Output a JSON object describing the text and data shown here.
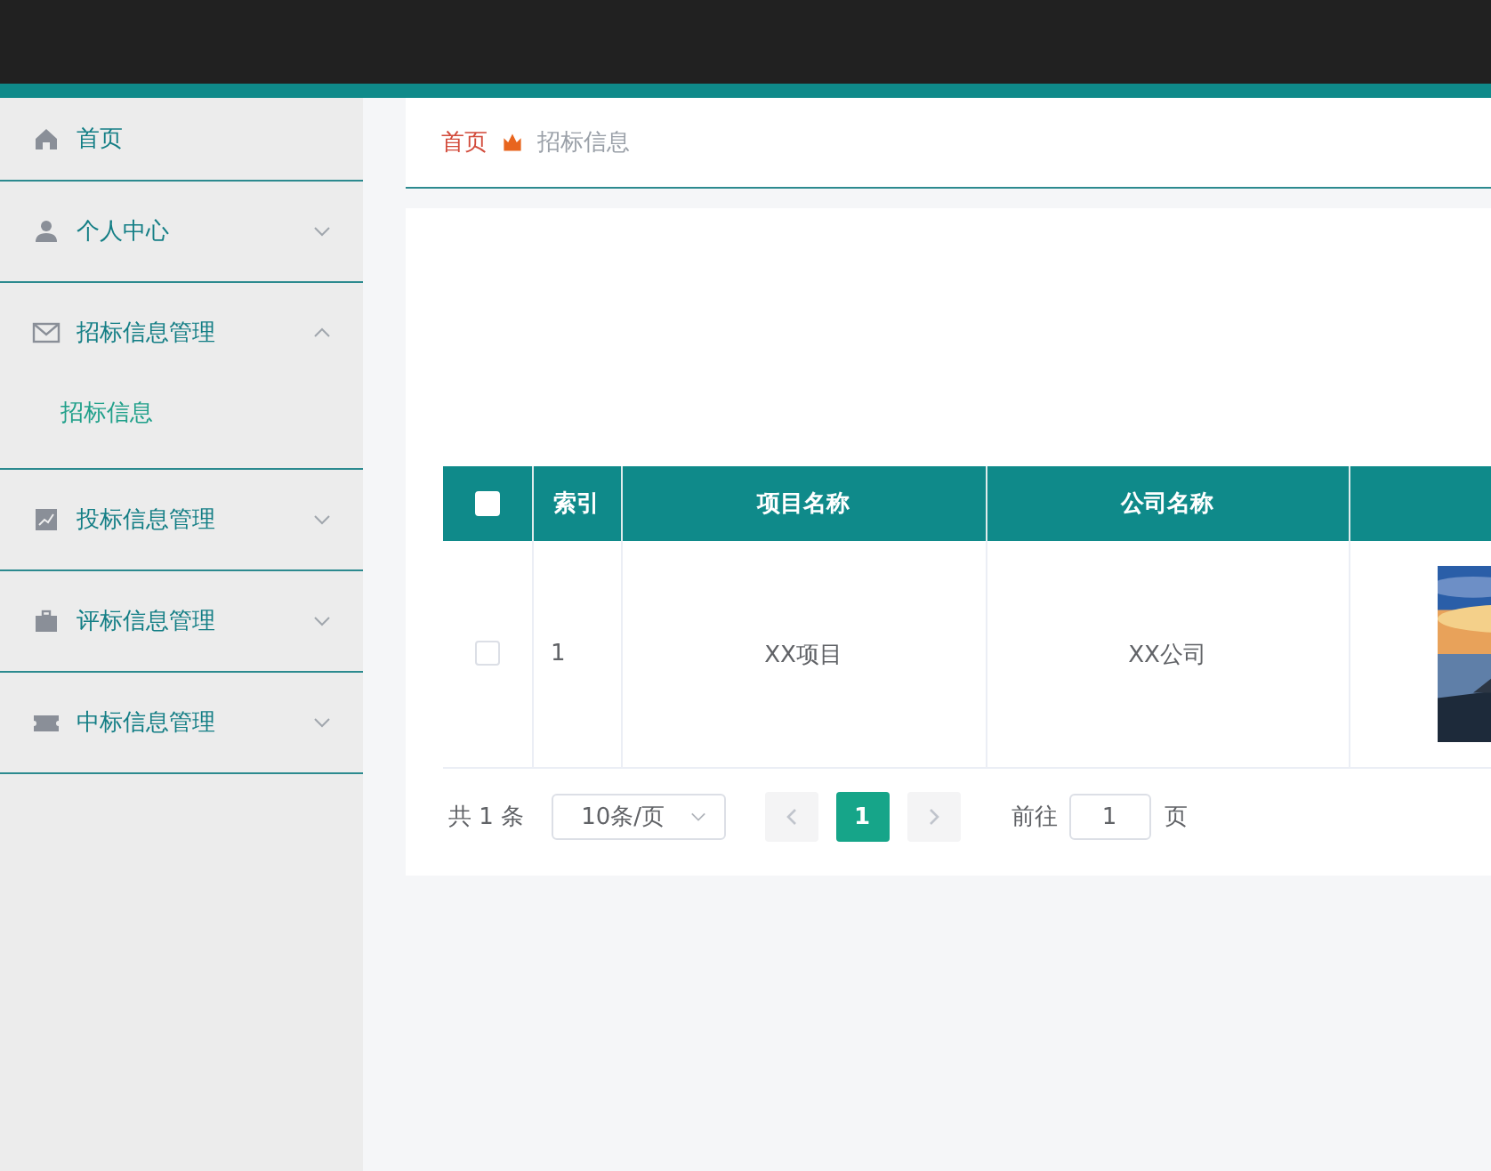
{
  "sidebar": {
    "items": [
      {
        "label": "首页",
        "kind": "link"
      },
      {
        "label": "个人中心",
        "kind": "group",
        "expanded": false
      },
      {
        "label": "招标信息管理",
        "kind": "group",
        "expanded": true,
        "children": [
          {
            "label": "招标信息",
            "selected": true
          }
        ]
      },
      {
        "label": "投标信息管理",
        "kind": "group",
        "expanded": false
      },
      {
        "label": "评标信息管理",
        "kind": "group",
        "expanded": false
      },
      {
        "label": "中标信息管理",
        "kind": "group",
        "expanded": false
      }
    ]
  },
  "breadcrumb": [
    {
      "label": "首页"
    },
    {
      "label": "招标信息"
    }
  ],
  "table": {
    "header_checked": false,
    "columns": [
      "索引",
      "项目名称",
      "公司名称"
    ],
    "rows": [
      {
        "checked": false,
        "index": "1",
        "project": "XX项目",
        "company": "XX公司"
      }
    ]
  },
  "pagination": {
    "total": "共 1 条",
    "page_size": "10条/页",
    "pages": [
      {
        "label": "1",
        "selected": true
      }
    ],
    "goto_label": "前往",
    "goto_value": "1",
    "goto_suffix": "页"
  }
}
